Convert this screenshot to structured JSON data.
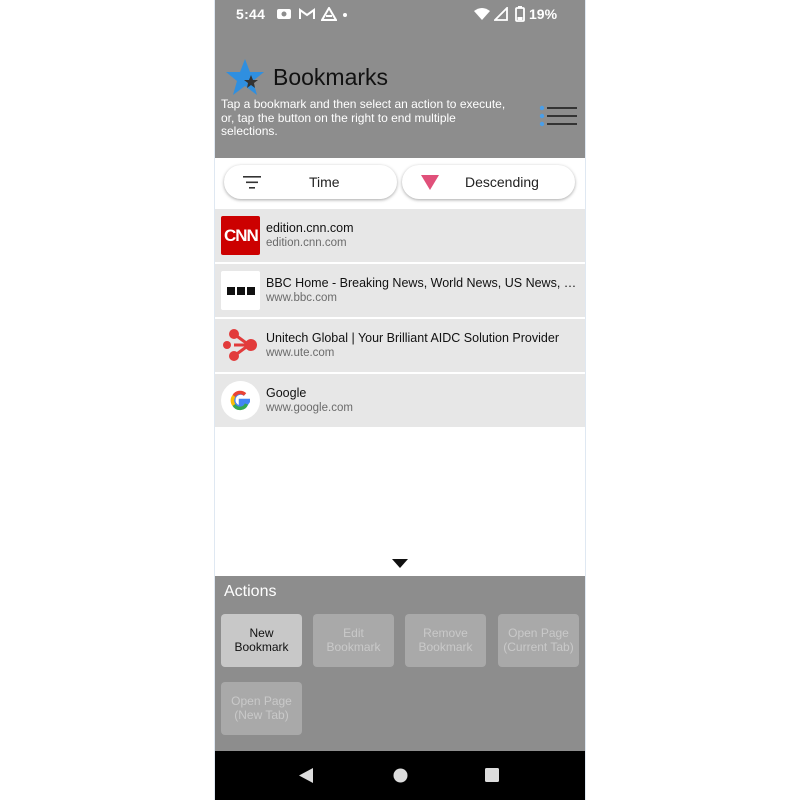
{
  "status_bar": {
    "time": "5:44",
    "battery": "19%",
    "icons": [
      "camera-icon",
      "gmail-icon",
      "drive-icon",
      "dot-icon",
      "wifi-icon",
      "signal-icon",
      "battery-icon"
    ]
  },
  "header": {
    "title": "Bookmarks",
    "description": "Tap a bookmark and then select an action to execute, or, tap the button on the right to end multiple selections.",
    "logo_icon": "star-icon",
    "menu_icon": "multi-select-list-icon"
  },
  "sort": {
    "field_label": "Time",
    "field_icon": "filter-lines-icon",
    "order_label": "Descending",
    "order_icon": "triangle-down-icon",
    "accent": "#e0507a"
  },
  "bookmarks": [
    {
      "title": "edition.cnn.com",
      "url": "edition.cnn.com",
      "icon": "cnn-logo-icon",
      "icon_text": "CNN"
    },
    {
      "title": "BBC Home - Breaking News, World News, US News, Sports, Business",
      "url": "www.bbc.com",
      "icon": "bbc-logo-icon"
    },
    {
      "title": "Unitech Global | Your Brilliant AIDC Solution Provider",
      "url": "www.ute.com",
      "icon": "unitech-logo-icon"
    },
    {
      "title": "Google",
      "url": "www.google.com",
      "icon": "google-logo-icon"
    }
  ],
  "actions": {
    "title": "Actions",
    "buttons": [
      {
        "label_line1": "New",
        "label_line2": "Bookmark",
        "enabled": true
      },
      {
        "label_line1": "Edit",
        "label_line2": "Bookmark",
        "enabled": false
      },
      {
        "label_line1": "Remove",
        "label_line2": "Bookmark",
        "enabled": false
      },
      {
        "label_line1": "Open Page",
        "label_line2": "(Current Tab)",
        "enabled": false
      },
      {
        "label_line1": "Open Page",
        "label_line2": "(New Tab)",
        "enabled": false
      }
    ]
  },
  "nav": {
    "back_icon": "back-triangle-icon",
    "home_icon": "home-circle-icon",
    "recents_icon": "recents-square-icon"
  },
  "colors": {
    "header_bg": "#8d8d8d",
    "row_bg": "#e7e7e7",
    "cnn_red": "#cc0000"
  }
}
